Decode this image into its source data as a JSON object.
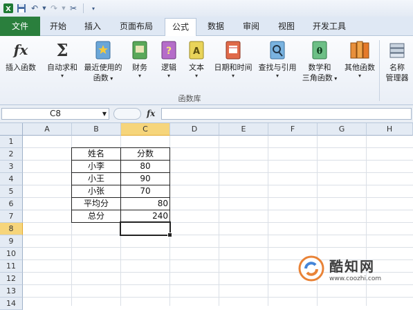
{
  "qat": {
    "icons": [
      "excel-app-icon",
      "save-icon",
      "undo-icon",
      "redo-icon",
      "format-painter-icon",
      "customize-qat-icon"
    ]
  },
  "tabs": [
    {
      "label": "文件",
      "active": false
    },
    {
      "label": "开始",
      "active": false
    },
    {
      "label": "插入",
      "active": false
    },
    {
      "label": "页面布局",
      "active": false
    },
    {
      "label": "公式",
      "active": true
    },
    {
      "label": "数据",
      "active": false
    },
    {
      "label": "审阅",
      "active": false
    },
    {
      "label": "视图",
      "active": false
    },
    {
      "label": "开发工具",
      "active": false
    }
  ],
  "ribbon": {
    "buttons": [
      {
        "label": "插入函数",
        "label2": "",
        "icon": "fx-icon",
        "caret": false
      },
      {
        "label": "自动求和",
        "label2": "",
        "icon": "sigma-icon",
        "caret": true
      },
      {
        "label": "最近使用的",
        "label2": "函数",
        "icon": "star-book-icon",
        "caret": true
      },
      {
        "label": "财务",
        "label2": "",
        "icon": "finance-book-icon",
        "caret": true
      },
      {
        "label": "逻辑",
        "label2": "",
        "icon": "logic-book-icon",
        "caret": true
      },
      {
        "label": "文本",
        "label2": "",
        "icon": "text-book-icon",
        "caret": true
      },
      {
        "label": "日期和时间",
        "label2": "",
        "icon": "datetime-book-icon",
        "caret": true
      },
      {
        "label": "查找与引用",
        "label2": "",
        "icon": "lookup-book-icon",
        "caret": true
      },
      {
        "label": "数学和",
        "label2": "三角函数",
        "icon": "math-book-icon",
        "caret": true
      },
      {
        "label": "其他函数",
        "label2": "",
        "icon": "more-books-icon",
        "caret": true
      },
      {
        "label": "名称",
        "label2": "管理器",
        "icon": "name-manager-icon",
        "caret": false
      }
    ],
    "group_label": "函数库"
  },
  "formula_bar": {
    "name_box": "C8",
    "fx_label": "fx",
    "formula": ""
  },
  "sheet": {
    "columns": [
      "A",
      "B",
      "C",
      "D",
      "E",
      "F",
      "G",
      "H"
    ],
    "selected_column": "C",
    "rows": [
      "1",
      "2",
      "3",
      "4",
      "5",
      "6",
      "7",
      "8",
      "9",
      "10",
      "11",
      "12",
      "13",
      "14"
    ],
    "selected_row": "8",
    "cells": {
      "B2": "姓名",
      "C2": "分数",
      "B3": "小李",
      "C3": "80",
      "B4": "小王",
      "C4": "90",
      "B5": "小张",
      "C5": "70",
      "B6": "平均分",
      "C6": "80",
      "B7": "总分",
      "C7": "240"
    }
  },
  "watermark": {
    "brand": "酷知网",
    "url": "www.coozhi.com"
  }
}
